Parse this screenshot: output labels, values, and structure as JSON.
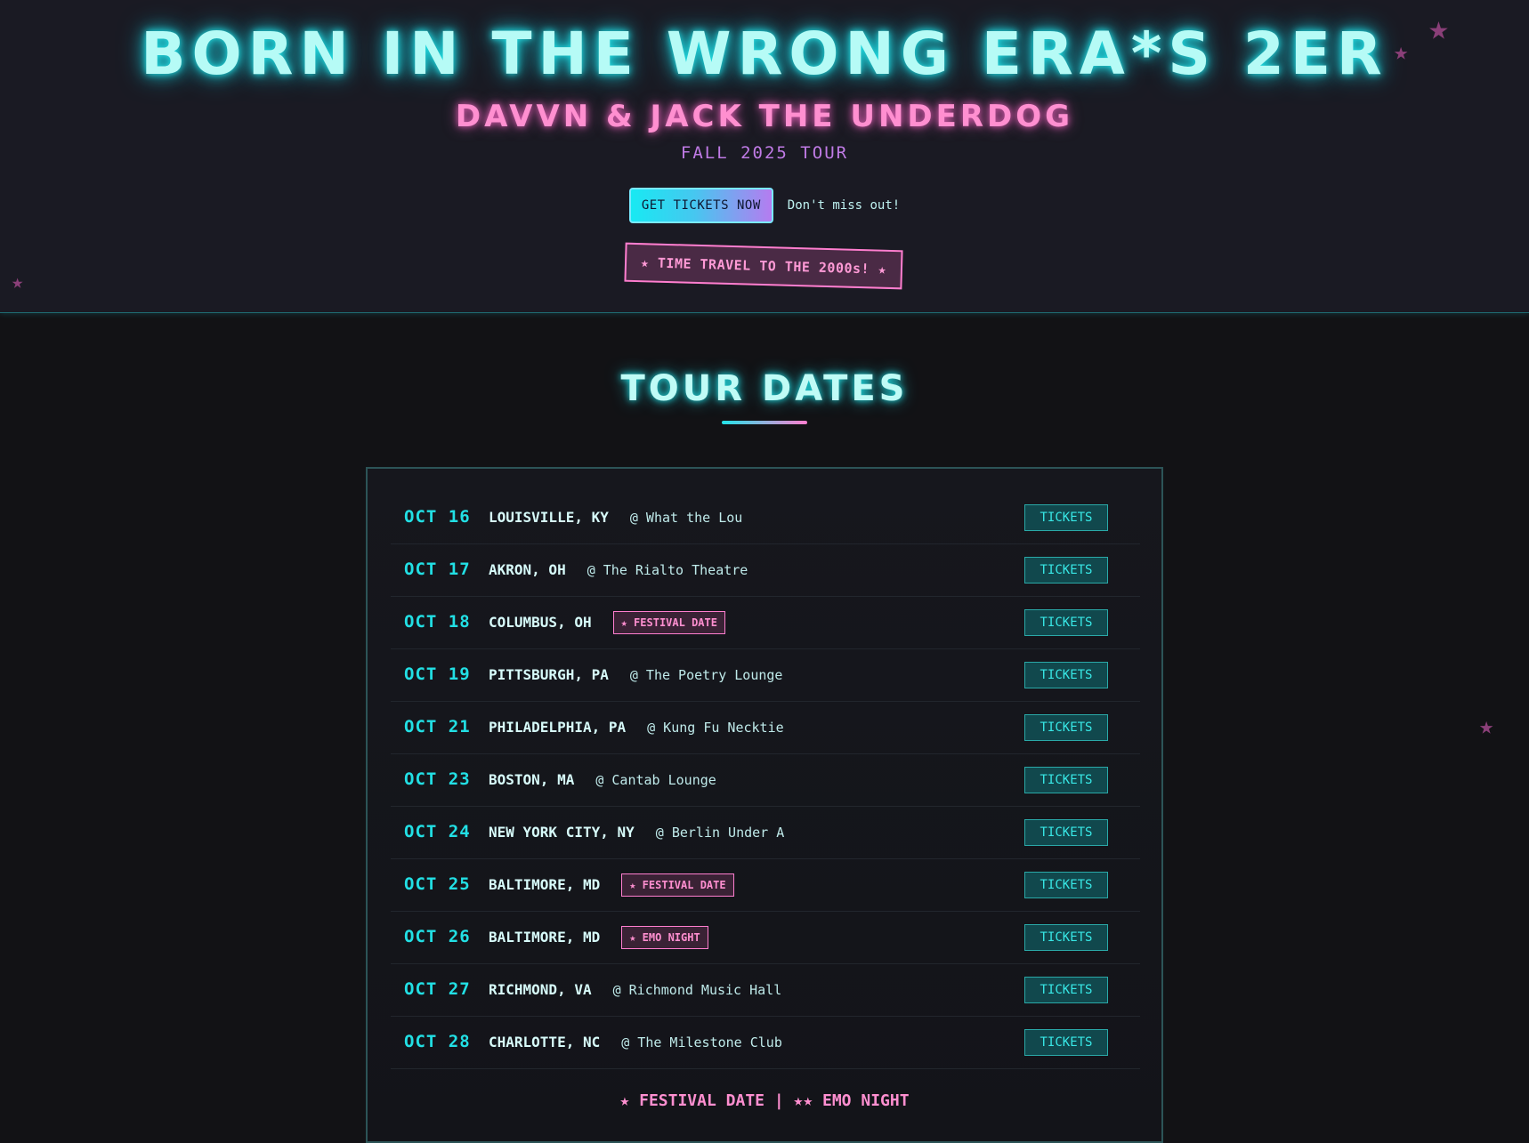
{
  "header": {
    "title": "BORN IN THE WRONG ERA*S 2ER",
    "subtitle": "DAVVN & JACK THE UNDERDOG",
    "season": "FALL 2025 TOUR",
    "cta_label": "GET TICKETS NOW",
    "cta_note": "Don't miss out!",
    "sticker": "★ TIME TRAVEL TO THE 2000s! ★"
  },
  "decor": {
    "star_glyph": "★"
  },
  "tour": {
    "title": "TOUR DATES",
    "legend": "★ FESTIVAL DATE | ★★ EMO NIGHT",
    "dates": [
      {
        "date": "OCT 16",
        "city": "LOUISVILLE, KY",
        "venue": "@ What the Lou",
        "badge": "",
        "ticket": "TICKETS"
      },
      {
        "date": "OCT 17",
        "city": "AKRON, OH",
        "venue": "@ The Rialto Theatre",
        "badge": "",
        "ticket": "TICKETS"
      },
      {
        "date": "OCT 18",
        "city": "COLUMBUS, OH",
        "venue": "",
        "badge": "★ FESTIVAL DATE",
        "ticket": "TICKETS"
      },
      {
        "date": "OCT 19",
        "city": "PITTSBURGH, PA",
        "venue": "@ The Poetry Lounge",
        "badge": "",
        "ticket": "TICKETS"
      },
      {
        "date": "OCT 21",
        "city": "PHILADELPHIA, PA",
        "venue": "@ Kung Fu Necktie",
        "badge": "",
        "ticket": "TICKETS"
      },
      {
        "date": "OCT 23",
        "city": "BOSTON, MA",
        "venue": "@ Cantab Lounge",
        "badge": "",
        "ticket": "TICKETS"
      },
      {
        "date": "OCT 24",
        "city": "NEW YORK CITY, NY",
        "venue": "@ Berlin Under A",
        "badge": "",
        "ticket": "TICKETS"
      },
      {
        "date": "OCT 25",
        "city": "BALTIMORE, MD",
        "venue": "",
        "badge": "★ FESTIVAL DATE",
        "ticket": "TICKETS"
      },
      {
        "date": "OCT 26",
        "city": "BALTIMORE, MD",
        "venue": "",
        "badge": "★ EMO NIGHT",
        "ticket": "TICKETS"
      },
      {
        "date": "OCT 27",
        "city": "RICHMOND, VA",
        "venue": "@ Richmond Music Hall",
        "badge": "",
        "ticket": "TICKETS"
      },
      {
        "date": "OCT 28",
        "city": "CHARLOTTE, NC",
        "venue": "@ The Milestone Club",
        "badge": "",
        "ticket": "TICKETS"
      }
    ]
  },
  "colors": {
    "neon_cyan": "#22e3e8",
    "neon_pink": "#ff7ecf",
    "purple": "#c07be6",
    "background": "#121215",
    "header_background": "#1a1a23"
  }
}
